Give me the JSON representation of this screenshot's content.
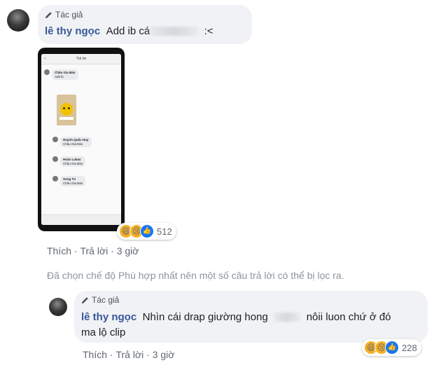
{
  "comment1": {
    "author_tag": "Tác giả",
    "name": "lê thy ngọc",
    "text_prefix": "Add ib cá",
    "text_suffix": ":<",
    "reactions": {
      "count": "512"
    },
    "actions": {
      "like": "Thích",
      "reply": "Trả lời",
      "time": "3 giờ"
    }
  },
  "phone_screenshot": {
    "title": "Trả lời",
    "poster_name": "Châu Gia Bảo",
    "poster_text": "Add ib",
    "replies": [
      {
        "name": "Huỳnh Quốc Huy",
        "text": "Châu Gia Bảo"
      },
      {
        "name": "Hoàn Lukas",
        "text": "Châu Gia Bảo"
      },
      {
        "name": "Song Tú",
        "text": "Châu Gia Bảo"
      }
    ]
  },
  "filter_note": "Đã chọn chế độ Phù hợp nhất nên một số câu trả lời có thể bị lọc ra.",
  "reply1": {
    "author_tag": "Tác giả",
    "name": "lê thy ngọc",
    "text_part1": "Nhìn cái drap giường hong",
    "text_part2": "nôii luon chứ ở đó",
    "text_line2": "ma lộ clip",
    "reactions": {
      "count": "228"
    },
    "actions": {
      "like": "Thích",
      "reply": "Trả lời",
      "time": "3 giờ"
    }
  },
  "icons": {
    "pencil": "pencil-icon",
    "haha": "haha-reaction-icon",
    "sad": "sad-reaction-icon",
    "like": "like-reaction-icon"
  },
  "colors": {
    "name_blue": "#385898",
    "bubble_bg": "#f0f2f5",
    "meta_gray": "#606770",
    "like_blue": "#1877f2",
    "haha_yellow": "#f7b125"
  }
}
